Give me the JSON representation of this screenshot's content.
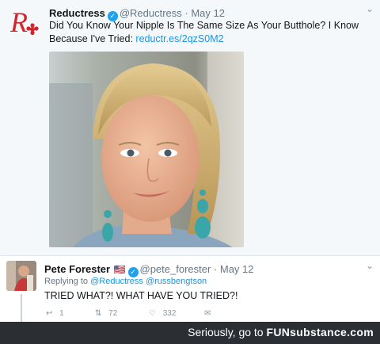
{
  "tweet": {
    "name": "Reductress",
    "handle": "@Reductress",
    "date": "May 12",
    "text": "Did You Know Your Nipple Is The Same Size As Your Butthole? I Know Because I've Tried:",
    "link": "reductr.es/2qzS0M2",
    "avatar_icon": "reductress-logo-icon"
  },
  "reply": {
    "name": "Pete Forester",
    "flag": "🇺🇸",
    "handle": "@pete_forester",
    "date": "May 12",
    "replying_prefix": "Replying to",
    "replying_to": "@Reductress @russbengtson",
    "text": "TRIED WHAT?! WHAT HAVE YOU TRIED?!",
    "reply_count": "1",
    "retweet_count": "72",
    "like_count": "332"
  },
  "footer": {
    "text_prefix": "Seriously, go to",
    "brand": "FUNsubstance.com"
  },
  "colors": {
    "accent": "#1da1f2",
    "link": "#1b95e0",
    "reductress_red": "#d4252f",
    "footer_bg": "#2b2e33"
  }
}
